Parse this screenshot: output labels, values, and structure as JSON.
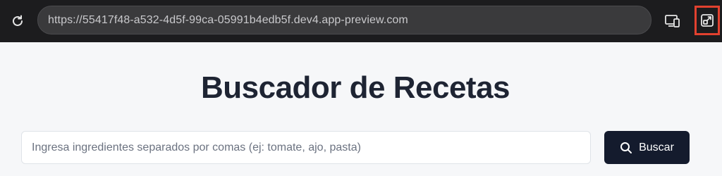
{
  "browser": {
    "url": "https://55417f48-a532-4d5f-99ca-05991b4edb5f.dev4.app-preview.com",
    "reload_icon": "reload-icon",
    "device_icon": "responsive-devices-icon",
    "popout_icon": "open-in-new-window-icon",
    "highlight_color": "#e2412f"
  },
  "page": {
    "title": "Buscador de Recetas",
    "search": {
      "placeholder": "Ingresa ingredientes separados por comas (ej: tomate, ajo, pasta)",
      "value": ""
    },
    "button": {
      "label": "Buscar",
      "icon": "search-icon"
    },
    "colors": {
      "title": "#1e2433",
      "button_bg": "#141b2d",
      "page_bg": "#f6f7f9"
    }
  }
}
